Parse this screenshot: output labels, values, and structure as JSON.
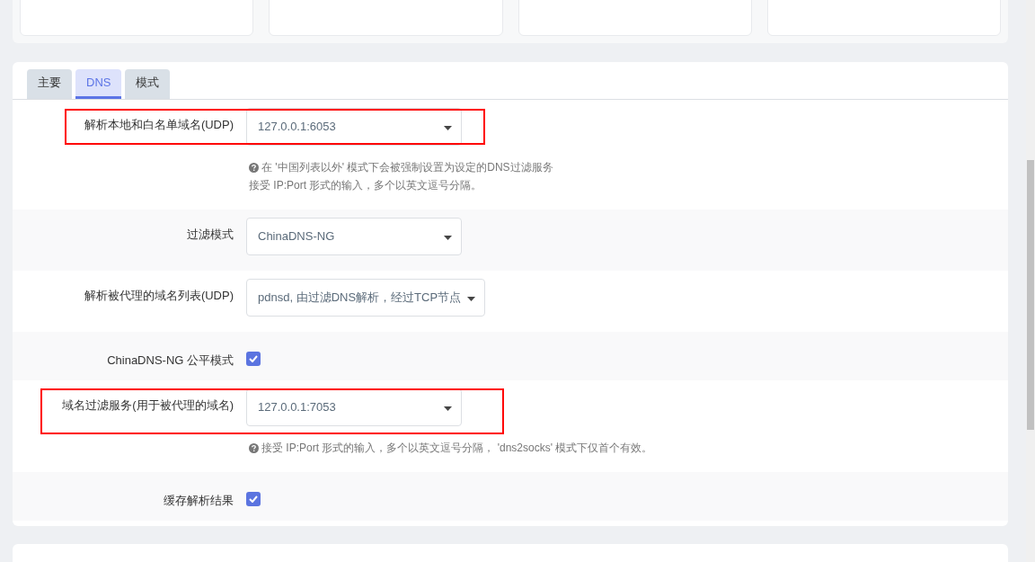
{
  "tabs": [
    {
      "label": "主要",
      "selected": false
    },
    {
      "label": "DNS",
      "selected": true
    },
    {
      "label": "模式",
      "selected": false
    }
  ],
  "rows": [
    {
      "kind": "select",
      "label": "解析本地和白名单域名(UDP)",
      "value": "127.0.0.1:6053",
      "highlighted": true,
      "wide": false,
      "help": [
        "在 '中国列表以外' 模式下会被强制设置为设定的DNS过滤服务",
        "接受 IP:Port 形式的输入，多个以英文逗号分隔。"
      ]
    },
    {
      "kind": "select",
      "label": "过滤模式",
      "value": "ChinaDNS-NG",
      "highlighted": false,
      "wide": false
    },
    {
      "kind": "select",
      "label": "解析被代理的域名列表(UDP)",
      "value": "pdnsd, 由过滤DNS解析，经过TCP节点",
      "highlighted": false,
      "wide": true
    },
    {
      "kind": "checkbox",
      "label": "ChinaDNS-NG 公平模式",
      "checked": true
    },
    {
      "kind": "select",
      "label": "域名过滤服务(用于被代理的域名)",
      "value": "127.0.0.1:7053",
      "highlighted": true,
      "wide": false,
      "help": [
        "接受 IP:Port 形式的输入，多个以英文逗号分隔， 'dns2socks' 模式下仅首个有效。"
      ]
    },
    {
      "kind": "checkbox",
      "label": "缓存解析结果",
      "checked": true
    }
  ]
}
